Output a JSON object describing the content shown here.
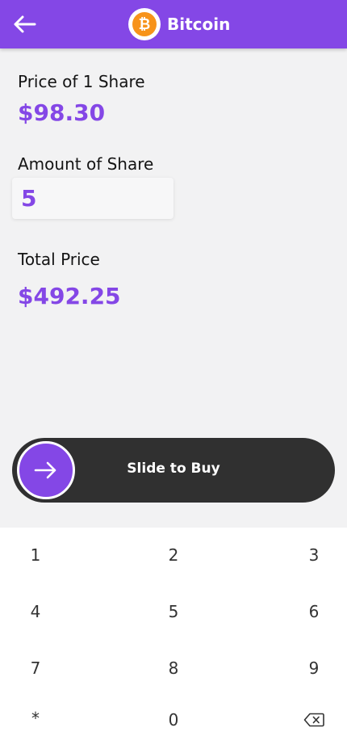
{
  "header": {
    "title": "Bitcoin",
    "back_icon": "arrow-left-icon",
    "coin_icon": "bitcoin-icon",
    "coin_symbol": "₿"
  },
  "price": {
    "label": "Price of 1 Share",
    "value": "$98.30"
  },
  "amount": {
    "label": "Amount of Share",
    "value": "5"
  },
  "total": {
    "label": "Total Price",
    "value": "$492.25"
  },
  "slider": {
    "label": "Slide to Buy",
    "icon": "arrow-right-icon"
  },
  "keypad": {
    "keys": [
      "1",
      "2",
      "3",
      "4",
      "5",
      "6",
      "7",
      "8",
      "9",
      "*",
      "0"
    ],
    "backspace_icon": "backspace-icon"
  },
  "colors": {
    "accent": "#8447e6",
    "bitcoin_orange": "#f7931a",
    "slider_bg": "#303030",
    "background": "#f2f2f3"
  }
}
